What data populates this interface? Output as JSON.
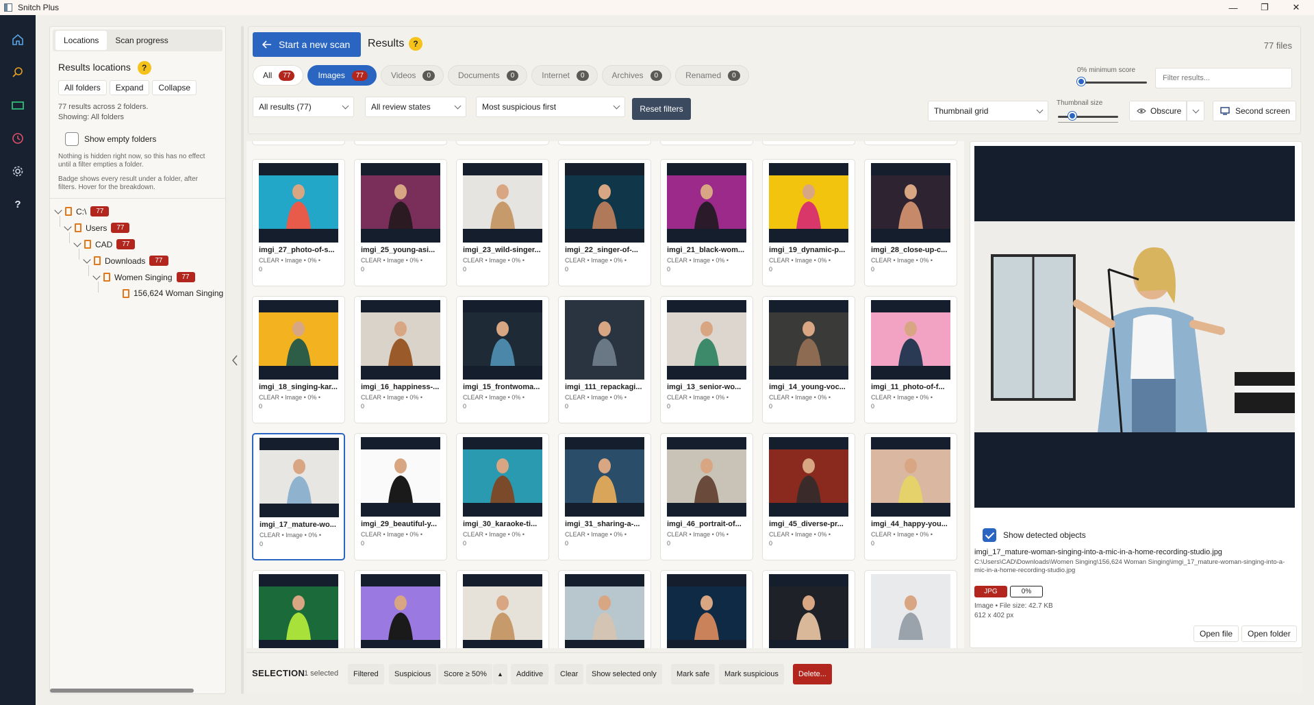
{
  "window": {
    "title": "Snitch Plus",
    "controls": [
      "—",
      "❐",
      "✕"
    ]
  },
  "rail": {
    "icons": [
      "home-icon",
      "search-icon",
      "media-icon",
      "history-icon",
      "settings-icon",
      "help-icon"
    ]
  },
  "left_panel": {
    "tabs": [
      "Locations",
      "Scan progress"
    ],
    "title": "Results locations",
    "help": "?",
    "buttons": [
      "All folders",
      "Expand",
      "Collapse"
    ],
    "info1": "77 results across 2 folders.",
    "info2": "Showing: All folders",
    "show_empty": "Show empty folders",
    "note1": "Nothing is hidden right now, so this has no effect until a filter empties a folder.",
    "note2": "Badge shows every result under a folder, after filters. Hover for the breakdown.",
    "tree": [
      {
        "label": "C:\\",
        "count": "77"
      },
      {
        "label": "Users",
        "count": "77"
      },
      {
        "label": "CAD",
        "count": "77"
      },
      {
        "label": "Downloads",
        "count": "77"
      },
      {
        "label": "Women Singing",
        "count": "77"
      },
      {
        "label": "156,624 Woman Singing",
        "count": ""
      }
    ]
  },
  "toolbar": {
    "new_scan": "Start a new scan",
    "results_title": "Results",
    "help": "?",
    "files": "77 files",
    "filter_tabs": [
      {
        "label": "All",
        "count": "77"
      },
      {
        "label": "Images",
        "count": "77"
      },
      {
        "label": "Videos",
        "count": "0"
      },
      {
        "label": "Documents",
        "count": "0"
      },
      {
        "label": "Internet",
        "count": "0"
      },
      {
        "label": "Archives",
        "count": "0"
      },
      {
        "label": "Renamed",
        "count": "0"
      }
    ],
    "min_score_label": "0% minimum score",
    "min_score_value": 0,
    "filter_placeholder": "Filter results...",
    "dd_results": "All results  (77)",
    "dd_review": "All review states",
    "dd_sort": "Most suspicious first",
    "reset": "Reset filters",
    "view_mode": "Thumbnail grid",
    "thumb_size_label": "Thumbnail size",
    "thumb_size_value": 0.2,
    "obscure": "Obscure",
    "second_screen": "Second screen"
  },
  "grid": {
    "meta": "CLEAR  •  Image  •  0%  •",
    "zero": "0",
    "cards": [
      {
        "name": "imgi_27_photo-of-s...",
        "bg": "#23a7c9",
        "fig": "#e85a4a"
      },
      {
        "name": "imgi_25_young-asi...",
        "bg": "#7a2f5a",
        "fig": "#2b1a22"
      },
      {
        "name": "imgi_23_wild-singer...",
        "bg": "#e6e4e0",
        "fig": "#c79a6b"
      },
      {
        "name": "imgi_22_singer-of-...",
        "bg": "#10364a",
        "fig": "#b07a5a"
      },
      {
        "name": "imgi_21_black-wom...",
        "bg": "#9b2a8a",
        "fig": "#2a1a2a"
      },
      {
        "name": "imgi_19_dynamic-p...",
        "bg": "#f2c40e",
        "fig": "#d9376a"
      },
      {
        "name": "imgi_28_close-up-c...",
        "bg": "#2e2330",
        "fig": "#c68a6a"
      },
      {
        "name": "imgi_18_singing-kar...",
        "bg": "#f3b21f",
        "fig": "#2d5c47"
      },
      {
        "name": "imgi_16_happiness-...",
        "bg": "#d9d3c9",
        "fig": "#9a5a2a"
      },
      {
        "name": "imgi_15_frontwoma...",
        "bg": "#1e2a36",
        "fig": "#4b87a8"
      },
      {
        "name": "imgi_111_repackagi...",
        "bg": "#2a3340",
        "fig": "#6a7785"
      },
      {
        "name": "imgi_13_senior-wo...",
        "bg": "#dcd6cf",
        "fig": "#3d8a6a"
      },
      {
        "name": "imgi_14_young-voc...",
        "bg": "#3a3a38",
        "fig": "#8d6a52"
      },
      {
        "name": "imgi_11_photo-of-f...",
        "bg": "#f2a3c3",
        "fig": "#2a3a55"
      },
      {
        "name": "imgi_17_mature-wo...",
        "bg": "#e7e6e2",
        "fig": "#8fb2cf"
      },
      {
        "name": "imgi_29_beautiful-y...",
        "bg": "#fafafa",
        "fig": "#1a1a1a"
      },
      {
        "name": "imgi_30_karaoke-ti...",
        "bg": "#2a9ab0",
        "fig": "#7a4a2a"
      },
      {
        "name": "imgi_31_sharing-a-...",
        "bg": "#2a4d6a",
        "fig": "#d9a55a"
      },
      {
        "name": "imgi_46_portrait-of...",
        "bg": "#c9c2b7",
        "fig": "#6a4a3a"
      },
      {
        "name": "imgi_45_diverse-pr...",
        "bg": "#8a2a1e",
        "fig": "#3a2a2a"
      },
      {
        "name": "imgi_44_happy-you...",
        "bg": "#d9b7a0",
        "fig": "#e6d26a"
      },
      {
        "name": "",
        "bg": "#1a6a3a",
        "fig": "#a8e13a"
      },
      {
        "name": "",
        "bg": "#9a7ae0",
        "fig": "#1a1a1a"
      },
      {
        "name": "",
        "bg": "#e7e2d9",
        "fig": "#c79a6b"
      },
      {
        "name": "",
        "bg": "#b8c6cd",
        "fig": "#d4c4b4"
      },
      {
        "name": "",
        "bg": "#0f2a45",
        "fig": "#c9825a"
      },
      {
        "name": "",
        "bg": "#1e2228",
        "fig": "#d9b89a"
      },
      {
        "name": "",
        "bg": "#e9eaec",
        "fig": "#9aa2ab"
      }
    ]
  },
  "preview": {
    "show_detected": "Show detected objects",
    "filename": "imgi_17_mature-woman-singing-into-a-mic-in-a-home-recording-studio.jpg",
    "path": "C:\\Users\\CAD\\Downloads\\Women Singing\\156,624 Woman Singing\\imgi_17_mature-woman-singing-into-a-mic-in-a-home-recording-studio.jpg",
    "type_tag": "JPG",
    "score_tag": "0%",
    "info": "Image • File size: 42.7 KB",
    "dims": "612 x 402 px",
    "open_file": "Open file",
    "open_folder": "Open folder"
  },
  "selection_bar": {
    "label": "SELECTION",
    "count": "1 selected",
    "buttons": [
      "Filtered",
      "Suspicious",
      "Score ≥ 50%",
      "▲",
      "Additive",
      "Clear",
      "Show selected only",
      "Mark safe",
      "Mark suspicious",
      "Delete..."
    ]
  },
  "colors": {
    "accent": "#2a66c1",
    "danger": "#b3261e",
    "rail": "#17212f"
  }
}
